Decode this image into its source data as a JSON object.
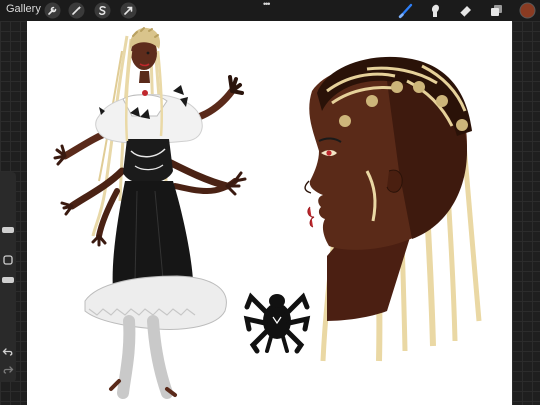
{
  "topbar": {
    "gallery_label": "Gallery",
    "more_label": "•••",
    "tools": [
      {
        "name": "wrench-icon"
      },
      {
        "name": "adjustments-icon"
      },
      {
        "name": "selection-icon"
      },
      {
        "name": "transform-icon"
      }
    ],
    "right_tools": [
      {
        "name": "brush-icon",
        "active": true
      },
      {
        "name": "smudge-icon"
      },
      {
        "name": "eraser-icon"
      },
      {
        "name": "layers-icon"
      },
      {
        "name": "color-swatch"
      }
    ],
    "active_color": "#8a3b22",
    "accent_color": "#2d7ff9"
  },
  "sidebar": {
    "buttons": [
      {
        "name": "brush-size-slider"
      },
      {
        "name": "modify-button"
      },
      {
        "name": "opacity-slider"
      },
      {
        "name": "undo-icon"
      },
      {
        "name": "redo-icon"
      }
    ]
  },
  "canvas": {
    "background": "#ffffff",
    "subjects": [
      "full-figure-drawing",
      "head-portrait-drawing",
      "spider-emblem-drawing"
    ]
  }
}
